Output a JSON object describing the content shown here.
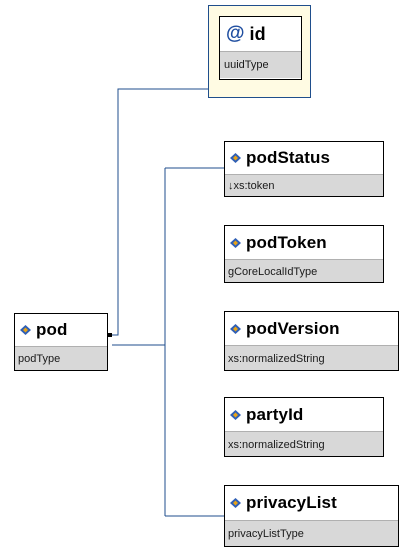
{
  "root": {
    "name": "pod",
    "type": "podType"
  },
  "attribute": {
    "symbol": "@",
    "name": "id",
    "type": "uuidType"
  },
  "children": [
    {
      "name": "podStatus",
      "type": "↓xs:token"
    },
    {
      "name": "podToken",
      "type": "gCoreLocalIdType"
    },
    {
      "name": "podVersion",
      "type": "xs:normalizedString"
    },
    {
      "name": "partyId",
      "type": "xs:normalizedString"
    },
    {
      "name": "privacyList",
      "type": "privacyListType"
    }
  ],
  "colors": {
    "connector_line": "#1f4e8c",
    "attribute_panel": "#fffbe3",
    "type_bar": "#d8d8d8",
    "element_icon_blue": "#2f5fb5",
    "element_icon_gold": "#e8a317"
  }
}
